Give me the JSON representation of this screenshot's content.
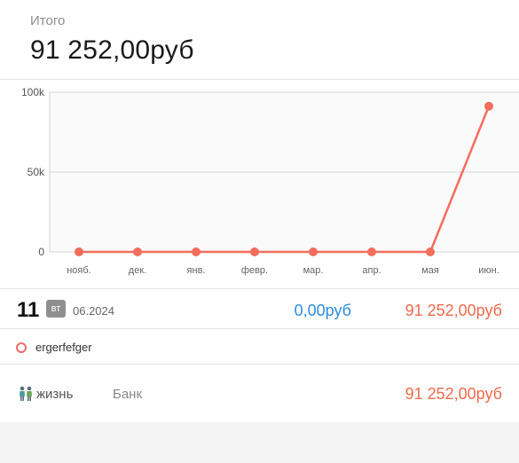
{
  "summary": {
    "total_label": "Итого",
    "total_value": "91 252,00руб"
  },
  "chart_data": {
    "type": "line",
    "categories": [
      "нояб.",
      "дек.",
      "янв.",
      "февр.",
      "мар.",
      "апр.",
      "мая",
      "июн."
    ],
    "values": [
      0,
      0,
      0,
      0,
      0,
      0,
      0,
      91252
    ],
    "y_tick_labels": [
      "0",
      "50k",
      "100k"
    ],
    "ylim": [
      0,
      100000
    ],
    "grid": true,
    "line_color": "#f26d5b"
  },
  "day": {
    "number": "11",
    "weekday": "вт",
    "month_year": "06.2024",
    "income": "0,00руб",
    "expense": "91 252,00руб"
  },
  "note": {
    "text": "ergerfefger"
  },
  "transaction": {
    "icon": "two-people-icon",
    "category": "жизнь",
    "account": "Банк",
    "amount": "91 252,00руб"
  }
}
